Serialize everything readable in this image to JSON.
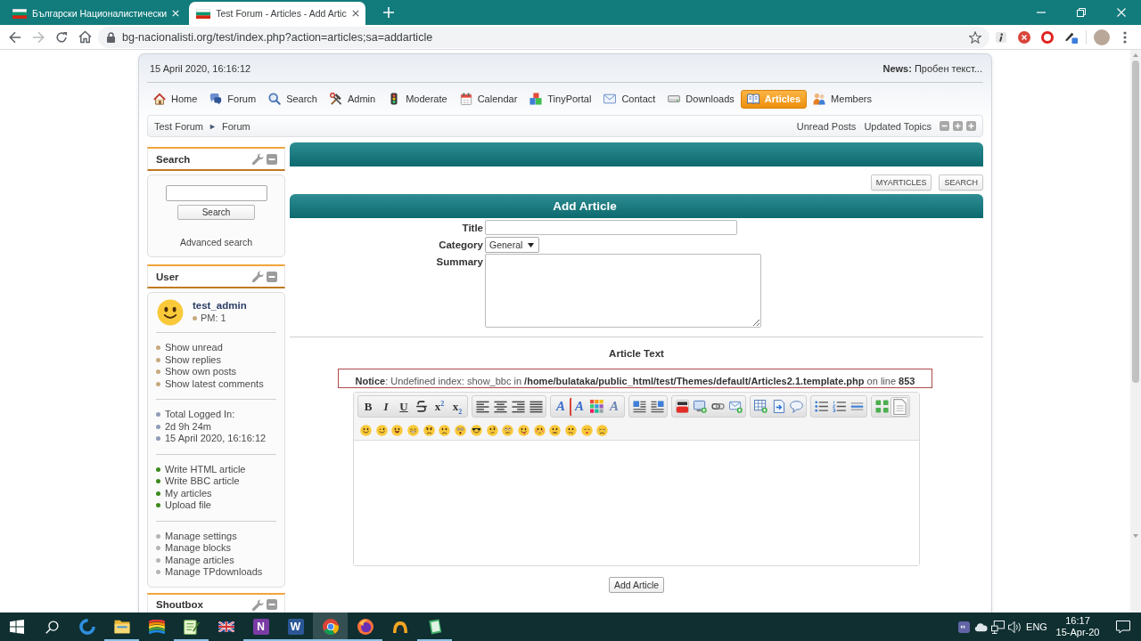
{
  "browser": {
    "tabs": [
      {
        "title": "Български Националистически",
        "selected": false
      },
      {
        "title": "Test Forum - Articles - Add Artic",
        "selected": true
      }
    ],
    "url": "bg-nacionalisti.org/test/index.php?action=articles;sa=addarticle"
  },
  "forum": {
    "date": "15 April 2020, 16:16:12",
    "news": "**News:** Пробен текст...",
    "nav": [
      {
        "label": "Home",
        "kind": "home",
        "selected": false
      },
      {
        "label": "Forum",
        "kind": "forum",
        "selected": false
      },
      {
        "label": "Search",
        "kind": "search",
        "selected": false
      },
      {
        "label": "Admin",
        "kind": "admin",
        "selected": false
      },
      {
        "label": "Moderate",
        "kind": "moderate",
        "selected": false
      },
      {
        "label": "Calendar",
        "kind": "calendar",
        "selected": false
      },
      {
        "label": "TinyPortal",
        "kind": "portal",
        "selected": false
      },
      {
        "label": "Contact",
        "kind": "contact",
        "selected": false
      },
      {
        "label": "Downloads",
        "kind": "downloads",
        "selected": false
      },
      {
        "label": "Articles",
        "kind": "articles",
        "selected": true
      },
      {
        "label": "Members",
        "kind": "members",
        "selected": false
      }
    ],
    "breadcrumb": {
      "items": [
        "Test Forum",
        "Forum"
      ],
      "separator": "►"
    },
    "quick_links": [
      "Unread Posts",
      "Updated Topics"
    ]
  },
  "sidebar": {
    "search_block": {
      "title": "Search",
      "button": "Search",
      "link": "Advanced search"
    },
    "user_block": {
      "title": "User",
      "username": "test_admin",
      "pm": "PM: 1",
      "groups": [
        {
          "color": "#c8a97e",
          "items": [
            "Show unread",
            "Show replies",
            "Show own posts",
            "Show latest comments"
          ]
        },
        {
          "color": "#8f9bb8",
          "items": [
            "Total Logged In:",
            "2d 9h 24m",
            "15 April 2020, 16:16:12"
          ]
        },
        {
          "color": "#3d8a1e",
          "items": [
            "Write HTML article",
            "Write BBC article",
            "My articles",
            "Upload file"
          ]
        },
        {
          "color": "#b5b5b5",
          "items": [
            "Manage settings",
            "Manage blocks",
            "Manage articles",
            "Manage TPdownloads"
          ]
        }
      ]
    },
    "shoutbox_block": {
      "title": "Shoutbox"
    }
  },
  "main": {
    "buttons": [
      "MYARTICLES",
      "SEARCH"
    ],
    "form_title": "Add Article",
    "fields": [
      {
        "kind": "text",
        "label": "Title"
      },
      {
        "kind": "select",
        "label": "Category",
        "value": "General"
      },
      {
        "kind": "textarea",
        "label": "Summary"
      }
    ],
    "section_label": "Article Text",
    "notice": "**Notice**: Undefined index: show_bbc in **/home/bulataka/public_html/test/Themes/default/Articles2.1.template.php** on line **853**",
    "toolbar_groups": [
      {
        "buttons": [
          {
            "kind": "bold",
            "glyph": "B",
            "active": false
          },
          {
            "kind": "italic",
            "glyph": "I",
            "active": false
          },
          {
            "kind": "underline",
            "glyph": "U",
            "active": false
          },
          {
            "kind": "strike",
            "active": false
          },
          {
            "kind": "superscript",
            "glyph": "x$^{2}$",
            "active": false
          },
          {
            "kind": "subscript",
            "glyph": "x$_{2}$",
            "active": false
          }
        ]
      },
      {
        "buttons": [
          {
            "kind": "alignleft",
            "active": false
          },
          {
            "kind": "center",
            "active": false
          },
          {
            "kind": "alignright",
            "active": false
          },
          {
            "kind": "justify",
            "active": false
          }
        ]
      },
      {
        "buttons": [
          {
            "kind": "font",
            "glyph": "A",
            "active": false
          },
          {
            "kind": "size",
            "glyph": "A",
            "active": false
          },
          {
            "kind": "color",
            "active": false
          },
          {
            "kind": "removeformat",
            "glyph": "A",
            "active": false
          }
        ]
      },
      {
        "buttons": [
          {
            "kind": "floatleft",
            "active": false
          },
          {
            "kind": "floatright",
            "active": false
          }
        ]
      },
      {
        "buttons": [
          {
            "kind": "video",
            "active": false
          },
          {
            "kind": "image",
            "active": false
          },
          {
            "kind": "link",
            "active": false
          },
          {
            "kind": "email",
            "active": false
          }
        ]
      },
      {
        "buttons": [
          {
            "kind": "table",
            "active": false
          },
          {
            "kind": "code",
            "active": false
          },
          {
            "kind": "quote",
            "active": false
          }
        ]
      },
      {
        "buttons": [
          {
            "kind": "bulletlist",
            "active": false
          },
          {
            "kind": "orderedlist",
            "active": false
          },
          {
            "kind": "rule",
            "active": false
          }
        ]
      },
      {
        "buttons": [
          {
            "kind": "maximize",
            "active": false
          },
          {
            "kind": "source",
            "active": true
          }
        ]
      }
    ],
    "emoticons": [
      {
        "kind": "smiley"
      },
      {
        "kind": "wink"
      },
      {
        "kind": "cheesy"
      },
      {
        "kind": "grin"
      },
      {
        "kind": "angry"
      },
      {
        "kind": "sad"
      },
      {
        "kind": "shocked"
      },
      {
        "kind": "cool"
      },
      {
        "kind": "huh"
      },
      {
        "kind": "rolleyes"
      },
      {
        "kind": "tongue"
      },
      {
        "kind": "embarrassed"
      },
      {
        "kind": "lipsrsealed"
      },
      {
        "kind": "undecided"
      },
      {
        "kind": "kiss"
      },
      {
        "kind": "cry"
      }
    ],
    "submit": "Add Article"
  },
  "taskbar": {
    "apps": [
      {
        "kind": "edge",
        "selected": false,
        "running": false
      },
      {
        "kind": "explorer",
        "selected": false,
        "running": true
      },
      {
        "kind": "stripes",
        "selected": false,
        "running": false
      },
      {
        "kind": "notepad",
        "selected": false,
        "running": true
      },
      {
        "kind": "flag",
        "selected": false,
        "running": false
      },
      {
        "kind": "onenote",
        "glyph": "N",
        "selected": false,
        "running": true
      },
      {
        "kind": "word",
        "glyph": "W",
        "selected": false,
        "running": true
      },
      {
        "kind": "chrome",
        "selected": true,
        "running": true
      },
      {
        "kind": "firefox",
        "selected": false,
        "running": true
      },
      {
        "kind": "arch",
        "selected": false,
        "running": false
      },
      {
        "kind": "notebook",
        "selected": false,
        "running": true
      }
    ],
    "tray": {
      "language": "ENG",
      "time": "16:17",
      "date": "15-Apr-20"
    }
  }
}
